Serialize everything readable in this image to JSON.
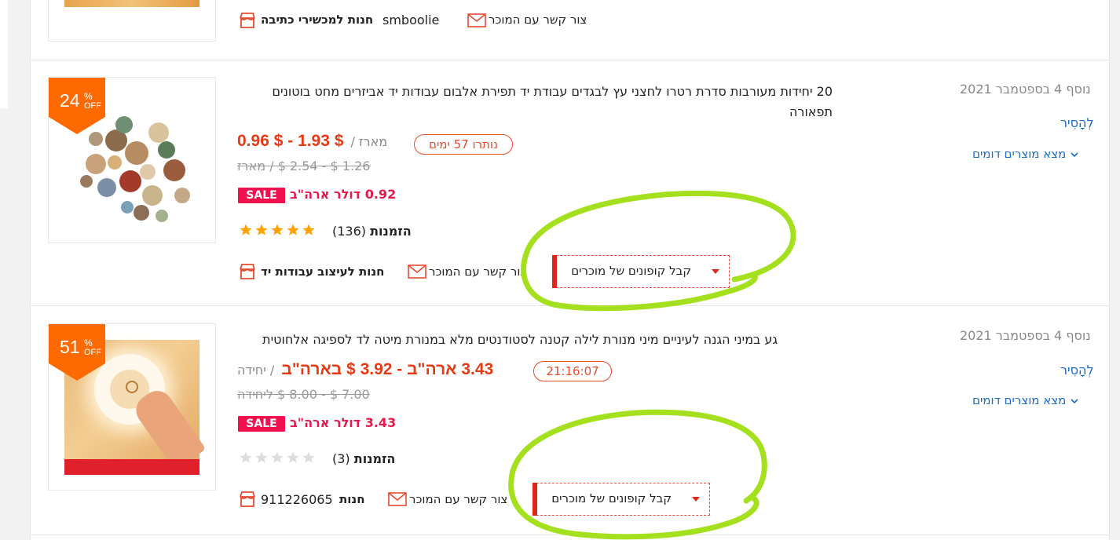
{
  "top_partial": {
    "store_name": "smboolie",
    "store_label": "חנות למכשירי כתיבה",
    "contact_label": "צור קשר עם המוכר"
  },
  "items": [
    {
      "discount_value": "24",
      "discount_percent_sign": "%",
      "discount_off": "OFF",
      "title": "20 יחידות מעורבות סדרת רטרו לחצני עץ לבגדים עבודת יד תפירת אלבום עבודות יד אביזרים מחט בוטונים תפאורה",
      "added_date": "נוסף 4 בספטמבר 2021",
      "remove_label": "לְהָסִיר",
      "find_similar_label": "מצא מוצרים דומים",
      "timer_label": "נותרו 57 ימים",
      "price_range": "0.96 $ - 1.93 $",
      "price_unit": "מארז /",
      "old_price": "1.26 $ - 2.54 $ / מארז",
      "sale_price_text": "0.92 דולר ארה\"ב",
      "sale_tag": "SALE",
      "rating": 5,
      "orders_label": "הזמנות",
      "orders_count": "(136)",
      "coupon_label": "קבל קופונים של מוכרים",
      "contact_label": "צור קשר עם המוכר",
      "store_label": "חנות לעיצוב עבודות יד"
    },
    {
      "discount_value": "51",
      "discount_percent_sign": "%",
      "discount_off": "OFF",
      "title": "גע במיני הגנה לעיניים מיני מנורת לילה קטנה לסטודנטים מלא במנורת מיטה לד לספיגה אלחוטית",
      "added_date": "נוסף 4 בספטמבר 2021",
      "remove_label": "לְהָסִיר",
      "find_similar_label": "מצא מוצרים דומים",
      "timer_label": "21:16:07",
      "price_range": "3.43 ארה\"ב - 3.92 $ בארה\"ב",
      "price_unit": "/ יחידה",
      "old_price": "7.00 $ - 8.00 $ ליחידה",
      "sale_price_text": "3.43 דולר ארה\"ב",
      "sale_tag": "SALE",
      "rating": 0,
      "orders_label": "הזמנות",
      "orders_count": "(3)",
      "coupon_label": "קבל קופונים של מוכרים",
      "contact_label": "צור קשר עם המוכר",
      "store_label": "חנות",
      "store_name": "911226065"
    }
  ],
  "colors": {
    "price_red": "#e63a15",
    "sale_pink": "#f0114f",
    "link_blue": "#1a6ec8",
    "badge_orange": "#ff6a00",
    "annotation_green": "#a5e01e",
    "star_orange": "#ffa200",
    "star_gray": "#dddddd"
  },
  "icons": [
    "store-icon",
    "mail-icon",
    "chevron-down-icon",
    "star-icon",
    "caret-down-icon"
  ]
}
